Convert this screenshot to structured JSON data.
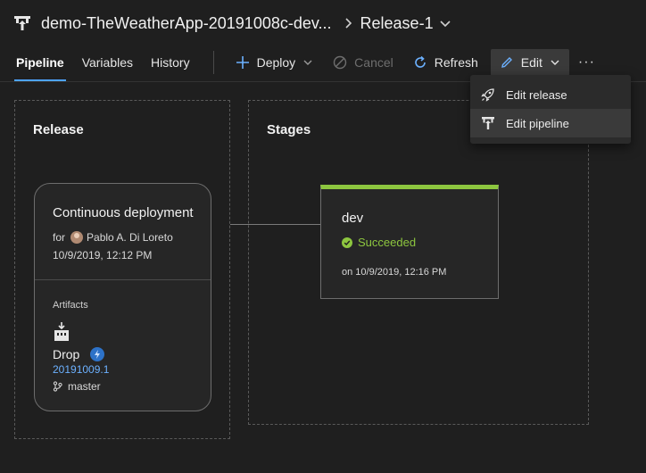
{
  "header": {
    "pipeline_name": "demo-TheWeatherApp-20191008c-dev...",
    "release_name": "Release-1"
  },
  "tabs": [
    {
      "label": "Pipeline"
    },
    {
      "label": "Variables"
    },
    {
      "label": "History"
    }
  ],
  "commands": {
    "deploy": "Deploy",
    "cancel": "Cancel",
    "refresh": "Refresh",
    "edit": "Edit",
    "more": "···"
  },
  "edit_menu": {
    "items": [
      {
        "label": "Edit release"
      },
      {
        "label": "Edit pipeline"
      }
    ]
  },
  "release_lane": {
    "title": "Release",
    "trigger": {
      "title": "Continuous deployment",
      "for_prefix": "for",
      "user": "Pablo A. Di Loreto",
      "date": "10/9/2019, 12:12 PM"
    },
    "artifacts": {
      "label": "Artifacts",
      "name": "Drop",
      "version": "20191009.1",
      "branch": "master"
    }
  },
  "stages_lane": {
    "title": "Stages",
    "stage": {
      "name": "dev",
      "status": "Succeeded",
      "time": "on 10/9/2019, 12:16 PM"
    }
  },
  "colors": {
    "accent": "#4da3ff",
    "success": "#8dc63f",
    "link": "#6cb1ff",
    "background": "#1f1f1f"
  },
  "icons": {
    "pipeline": "release-pipeline-icon",
    "breadcrumb": "chevron-right-icon",
    "deploy": "plus-icon",
    "cancel": "cancel-icon",
    "refresh": "refresh-icon",
    "edit": "pencil-icon",
    "edit_release": "rocket-icon",
    "edit_pipeline": "pipeline-icon",
    "artifact": "build-artifact-icon",
    "trigger_badge": "lightning-icon",
    "branch": "branch-icon",
    "status": "check-circle-icon"
  }
}
